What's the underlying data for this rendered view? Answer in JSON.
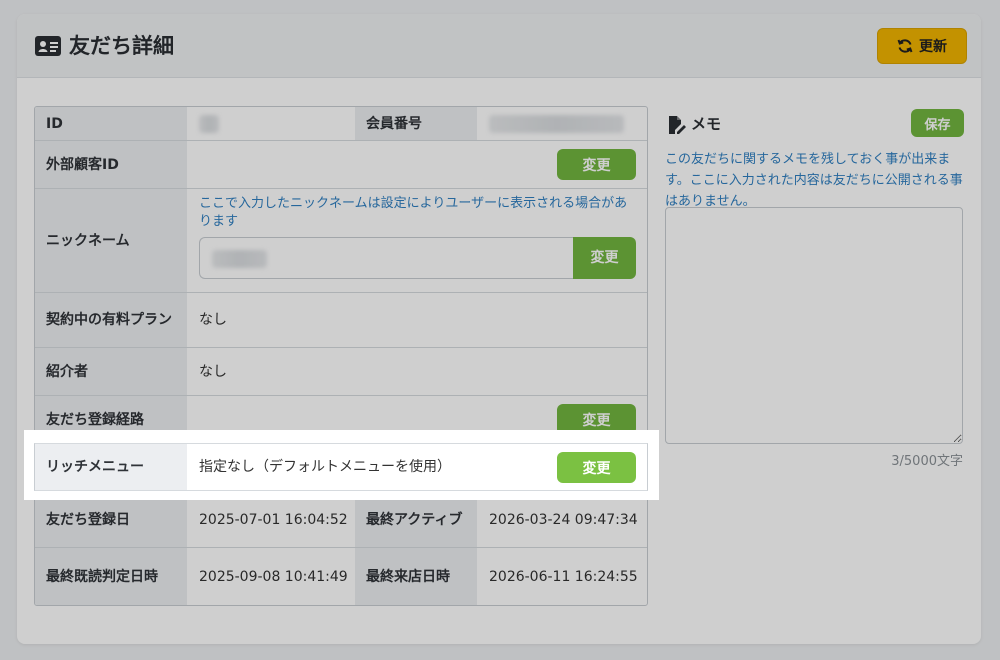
{
  "header": {
    "title": "友だち詳細",
    "refresh_label": "更新",
    "accent": "#f0b400"
  },
  "detail": {
    "rows": [
      {
        "label": "ID",
        "label2": "会員番号"
      },
      {
        "label": "外部顧客ID",
        "button": "変更"
      },
      {
        "label": "ニックネーム",
        "note": "ここで入力したニックネームは設定によりユーザーに表示される場合があります",
        "button": "変更"
      },
      {
        "label": "契約中の有料プラン",
        "value": "なし"
      },
      {
        "label": "紹介者",
        "value": "なし"
      },
      {
        "label": "友だち登録経路",
        "button": "変更"
      },
      {
        "label": "リッチメニュー",
        "value": "指定なし（デフォルトメニューを使用）",
        "button": "変更"
      },
      {
        "label": "友だち登録日",
        "value": "2025-07-01 16:04:52",
        "label2": "最終アクティブ",
        "value2": "2026-03-24 09:47:34"
      },
      {
        "label": "最終既読判定日時",
        "value": "2025-09-08 10:41:49",
        "label2": "最終来店日時",
        "value2": "2026-06-11 16:24:55"
      }
    ],
    "button_color": "#72b53f"
  },
  "memo": {
    "title": "メモ",
    "save_label": "保存",
    "note": "この友だちに関するメモを残しておく事が出来ます。ここに入力された内容は友だちに公開される事はありません。",
    "count": "3/5000文字",
    "value": ""
  }
}
